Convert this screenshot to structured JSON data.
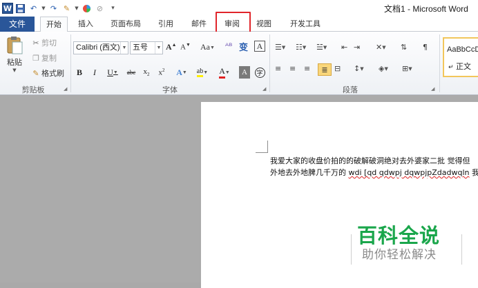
{
  "window": {
    "title": "文档1 - Microsoft Word"
  },
  "tabs": [
    {
      "label": "文件"
    },
    {
      "label": "开始"
    },
    {
      "label": "插入"
    },
    {
      "label": "页面布局"
    },
    {
      "label": "引用"
    },
    {
      "label": "邮件"
    },
    {
      "label": "审阅"
    },
    {
      "label": "视图"
    },
    {
      "label": "开发工具"
    }
  ],
  "clipboard": {
    "paste": "粘贴",
    "cut": "剪切",
    "copy": "复制",
    "painter": "格式刷",
    "group": "剪贴板"
  },
  "font": {
    "name": "Calibri (西文)",
    "size": "五号",
    "group": "字体",
    "aa": "Aa"
  },
  "paragraph": {
    "group": "段落"
  },
  "styles": {
    "sample": "AaBbCcD",
    "normal": "正文"
  },
  "document": {
    "line1": "我爱大家的收盘价拍的的破解破洞绝对去外婆家二批  觉得但",
    "line2_a": "外地去外地脾几千万的 ",
    "line2_b": "wdi [qd qdwpj dqwpjpZdadwqln",
    "line2_c": " 我即使"
  },
  "watermark": {
    "title": "百科全说",
    "subtitle": "助你轻松解决"
  },
  "colors": {
    "file_tab": "#2a5699",
    "highlight": "#e0242a",
    "watermark_green": "#1aa64b"
  }
}
